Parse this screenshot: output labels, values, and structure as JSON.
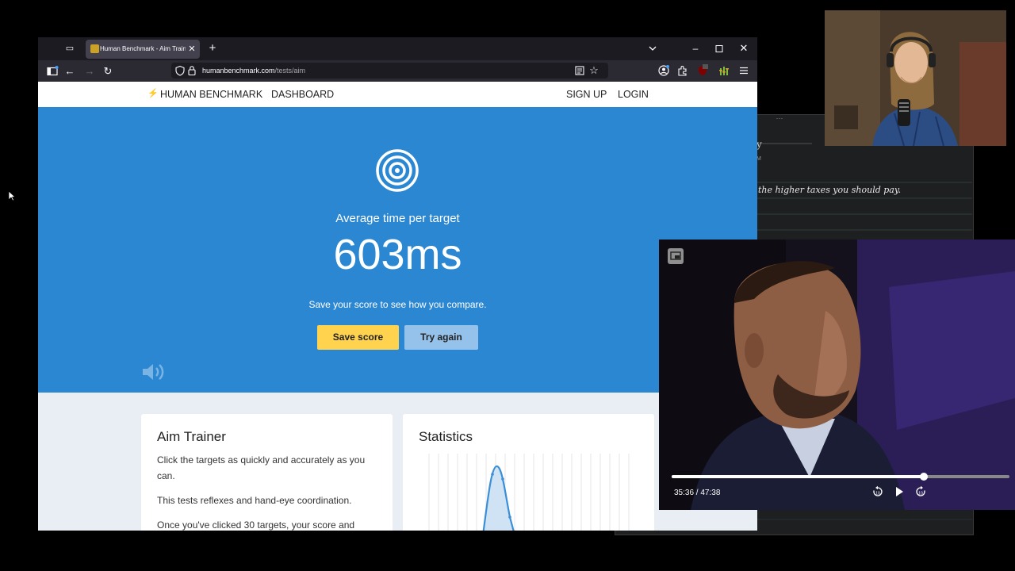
{
  "browser": {
    "tab_title": "Human Benchmark - Aim Trainer",
    "url_host": "humanbenchmark.com",
    "url_path": "/tests/aim"
  },
  "site": {
    "brand": "HUMAN BENCHMARK",
    "nav": [
      "DASHBOARD"
    ],
    "auth": [
      "SIGN UP",
      "LOGIN"
    ]
  },
  "hero": {
    "icon": "target-icon",
    "subtitle": "Average time per target",
    "score": "603ms",
    "prompt": "Save your score to see how you compare.",
    "save_label": "Save score",
    "try_label": "Try again",
    "color": "#2b87d1"
  },
  "aim_card": {
    "title": "Aim Trainer",
    "paragraphs": [
      "Click the targets as quickly and accurately as you can.",
      "This tests reflexes and hand-eye coordination.",
      "Once you've clicked 30 targets, your score and"
    ]
  },
  "stats_card": {
    "title": "Statistics"
  },
  "notes": {
    "handwriting": "the higher taxes you should pay."
  },
  "video": {
    "time": "35:36 / 47:38",
    "progress": 0.747
  },
  "colors": {
    "save_button": "#ffd34e",
    "try_button": "#95c2ea",
    "page_bg": "#e9eef5"
  }
}
